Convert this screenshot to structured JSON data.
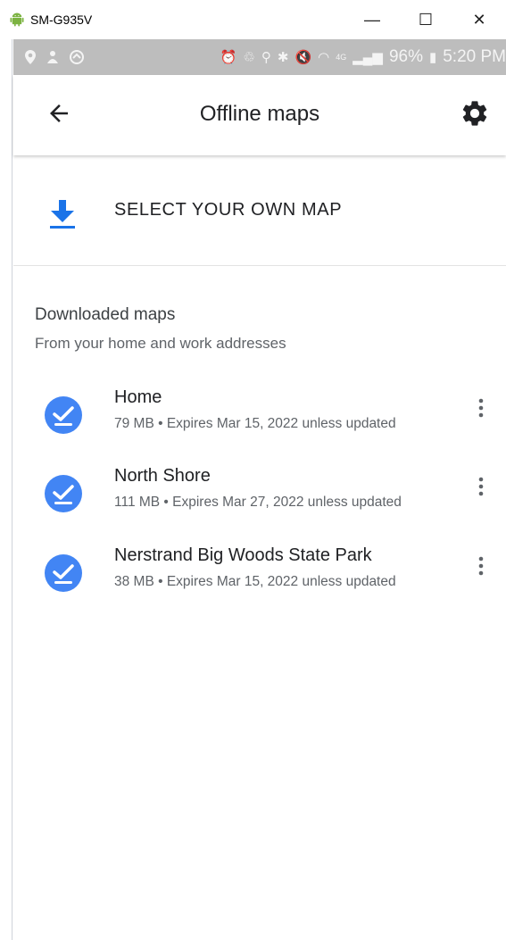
{
  "window": {
    "title": "SM-G935V",
    "minimize_glyph": "—",
    "maximize_glyph": "☐",
    "close_glyph": "✕"
  },
  "statusbar": {
    "battery": "96%",
    "time": "5:20 PM",
    "network": "4G"
  },
  "appbar": {
    "title": "Offline maps"
  },
  "select_own_map": {
    "label": "SELECT YOUR OWN MAP"
  },
  "downloaded": {
    "title": "Downloaded maps",
    "subtitle": "From your home and work addresses",
    "items": [
      {
        "name": "Home",
        "meta": "79 MB • Expires Mar 15, 2022 unless updated"
      },
      {
        "name": "North Shore",
        "meta": "111 MB • Expires Mar 27, 2022 unless updated"
      },
      {
        "name": "Nerstrand Big Woods State Park",
        "meta": "38 MB • Expires Mar 15, 2022 unless updated"
      }
    ]
  },
  "colors": {
    "accent_blue": "#1a73e8",
    "check_blue": "#4285f4",
    "statusbar_bg": "#bdbdbd",
    "android_green": "#7cb342"
  },
  "icons": {
    "back": "arrow-back-icon",
    "settings": "gear-icon",
    "download": "download-icon",
    "check": "check-circle-icon",
    "more": "more-vert-icon"
  }
}
